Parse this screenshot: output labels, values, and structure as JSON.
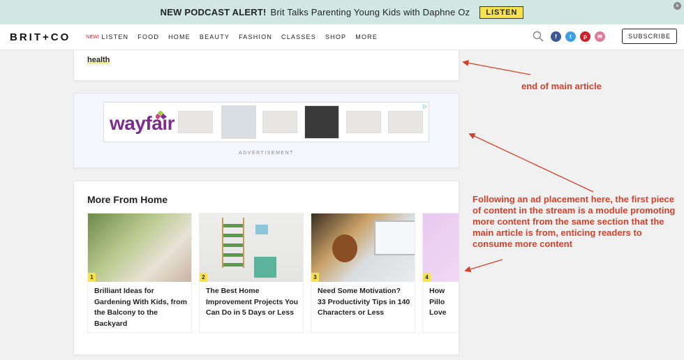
{
  "promo": {
    "alert": "NEW PODCAST ALERT!",
    "text": "Brit Talks Parenting Young Kids with Daphne Oz",
    "button": "LISTEN",
    "close": "×"
  },
  "nav": {
    "logo": "BRIT+CO",
    "new_badge": "NEW!",
    "items": [
      "LISTEN",
      "FOOD",
      "HOME",
      "BEAUTY",
      "FASHION",
      "CLASSES",
      "SHOP",
      "MORE"
    ],
    "social": [
      "f",
      "t",
      "p",
      "✉"
    ],
    "subscribe": "SUBSCRIBE"
  },
  "article_end": {
    "tag": "health"
  },
  "ad": {
    "brand": "wayfair",
    "label": "ADVERTISEMENT",
    "adchoices": "▷"
  },
  "more_from": {
    "title": "More From Home",
    "tiles": [
      {
        "num": "1",
        "title": "Brilliant Ideas for Gardening With Kids, from the Balcony to the Backyard"
      },
      {
        "num": "2",
        "title": "The Best Home Improvement Projects You Can Do in 5 Days or Less"
      },
      {
        "num": "3",
        "title": "Need Some Motivation? 33 Productivity Tips in 140 Characters or Less"
      },
      {
        "num": "4",
        "title": "How Pillo Love"
      }
    ]
  },
  "annotations": {
    "end": "end of main article",
    "following": "Following an ad placement here, the first piece of content in the stream is a module promoting more content from the same section that the main article is from, enticing readers to consume more content"
  },
  "colors": {
    "accent_yellow": "#f6e24e",
    "annotation_red": "#d4412a",
    "promo_bg": "#d3e7e2"
  }
}
